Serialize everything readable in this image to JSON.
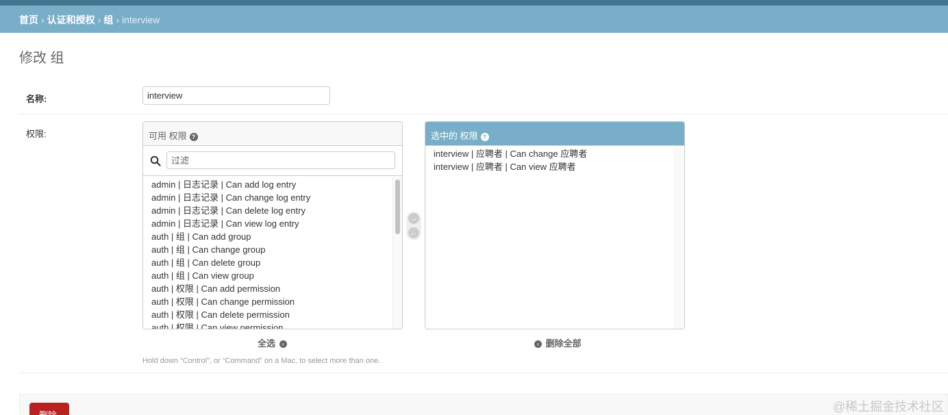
{
  "breadcrumbs": {
    "home": "首页",
    "app": "认证和授权",
    "model": "组",
    "current": "interview",
    "separator": "›"
  },
  "page": {
    "title": "修改 组"
  },
  "form": {
    "name_label": "名称:",
    "name_value": "interview",
    "permissions_label": "权限:"
  },
  "available": {
    "title": "可用 权限",
    "help_icon": "question-icon",
    "filter_placeholder": "过滤",
    "options": [
      "admin | 日志记录 | Can add log entry",
      "admin | 日志记录 | Can change log entry",
      "admin | 日志记录 | Can delete log entry",
      "admin | 日志记录 | Can view log entry",
      "auth | 组 | Can add group",
      "auth | 组 | Can change group",
      "auth | 组 | Can delete group",
      "auth | 组 | Can view group",
      "auth | 权限 | Can add permission",
      "auth | 权限 | Can change permission",
      "auth | 权限 | Can delete permission",
      "auth | 权限 | Can view permission"
    ],
    "choose_all": "全选"
  },
  "chosen": {
    "title": "选中的 权限",
    "help_icon": "question-icon",
    "options": [
      "interview | 应聘者 | Can change 应聘者",
      "interview | 应聘者 | Can view 应聘者"
    ],
    "remove_all": "删除全部"
  },
  "help_text": "Hold down “Control”, or “Command” on a Mac, to select more than one.",
  "actions": {
    "delete_label": "删除"
  },
  "watermark": "@稀土掘金技术社区",
  "colors": {
    "header": "#417690",
    "breadcrumb_bg": "#79aec8",
    "delete": "#ba2121"
  }
}
